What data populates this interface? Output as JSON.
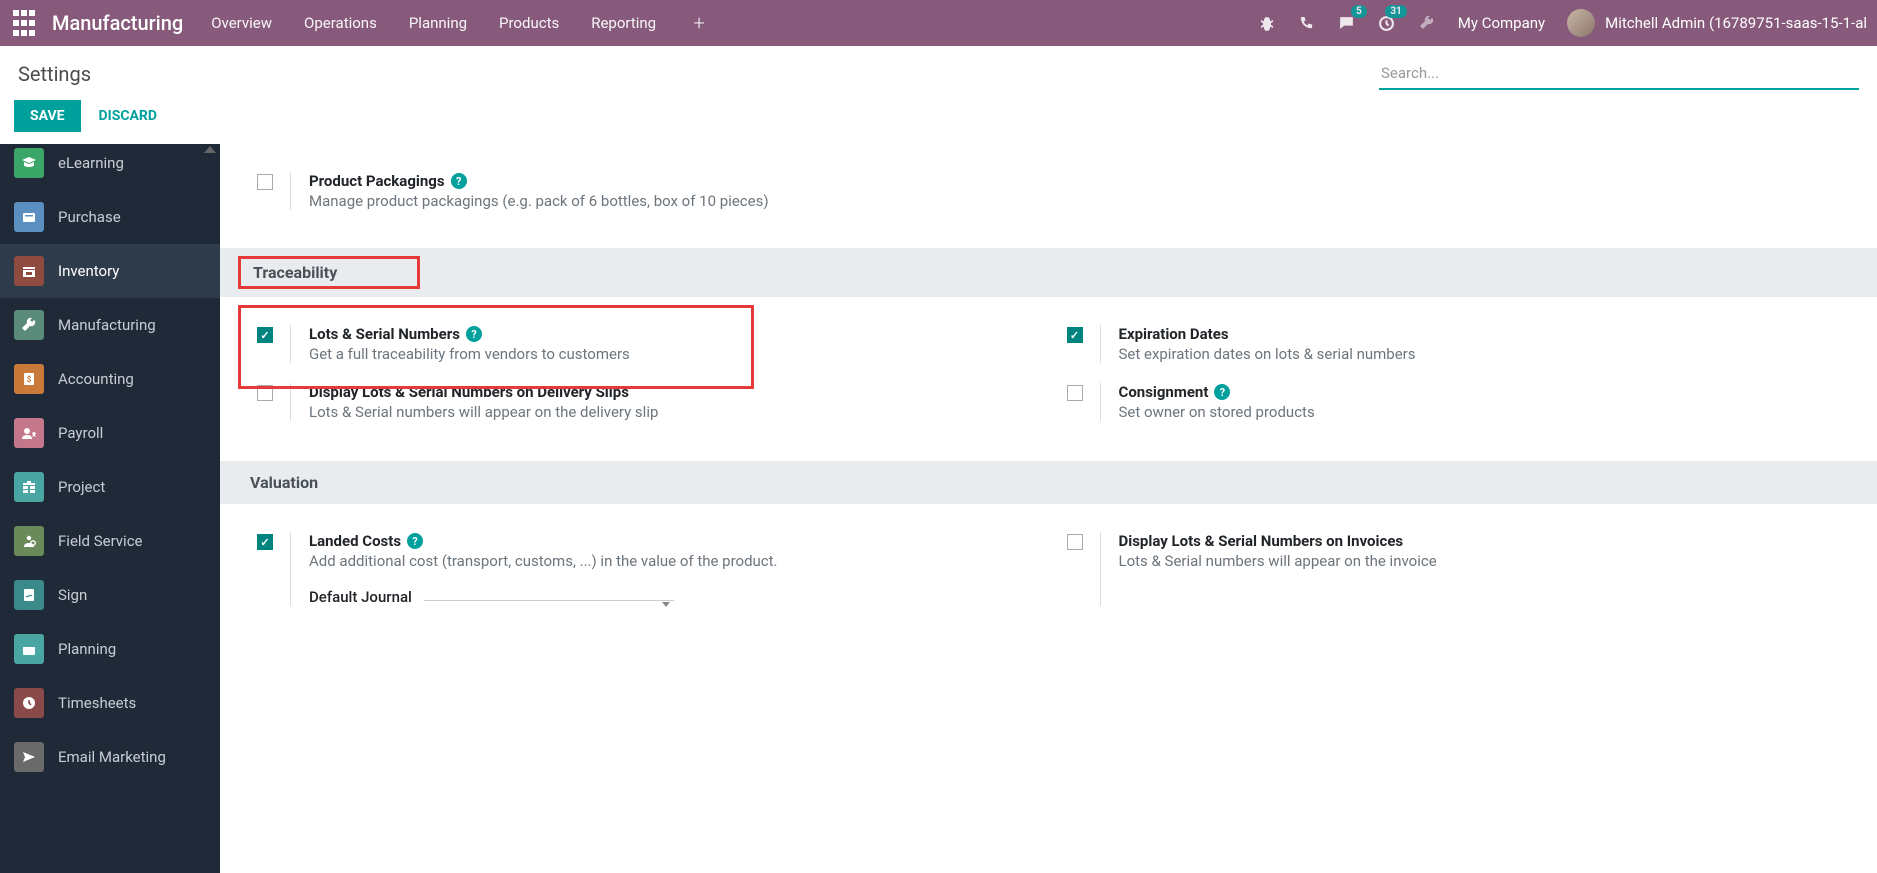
{
  "topbar": {
    "title": "Manufacturing",
    "nav": [
      "Overview",
      "Operations",
      "Planning",
      "Products",
      "Reporting"
    ],
    "messages_badge": "5",
    "activities_badge": "31",
    "company": "My Company",
    "user": "Mitchell Admin (16789751-saas-15-1-al"
  },
  "subheader": {
    "title": "Settings",
    "search_placeholder": "Search..."
  },
  "actions": {
    "save": "SAVE",
    "discard": "DISCARD"
  },
  "sidebar": {
    "items": [
      {
        "label": "eLearning",
        "color": "#3aa668"
      },
      {
        "label": "Purchase",
        "color": "#5a8fbf"
      },
      {
        "label": "Inventory",
        "color": "#8f4b3f",
        "active": true
      },
      {
        "label": "Manufacturing",
        "color": "#5a8a7a"
      },
      {
        "label": "Accounting",
        "color": "#c97a3a"
      },
      {
        "label": "Payroll",
        "color": "#c4768a"
      },
      {
        "label": "Project",
        "color": "#4aa6a3"
      },
      {
        "label": "Field Service",
        "color": "#6a8a5a"
      },
      {
        "label": "Sign",
        "color": "#3a8a8a"
      },
      {
        "label": "Planning",
        "color": "#4aa6a3"
      },
      {
        "label": "Timesheets",
        "color": "#8b4a4a"
      },
      {
        "label": "Email Marketing",
        "color": "#6a6a6a"
      }
    ]
  },
  "settings": {
    "top": {
      "packagings": {
        "label": "Product Packagings",
        "desc": "Manage product packagings (e.g. pack of 6 bottles, box of 10 pieces)"
      }
    },
    "traceability": {
      "title": "Traceability",
      "lots": {
        "label": "Lots & Serial Numbers",
        "desc": "Get a full traceability from vendors to customers"
      },
      "expiration": {
        "label": "Expiration Dates",
        "desc": "Set expiration dates on lots & serial numbers"
      },
      "delivery_slips": {
        "label": "Display Lots & Serial Numbers on Delivery Slips",
        "desc": "Lots & Serial numbers will appear on the delivery slip"
      },
      "consignment": {
        "label": "Consignment",
        "desc": "Set owner on stored products"
      }
    },
    "valuation": {
      "title": "Valuation",
      "landed": {
        "label": "Landed Costs",
        "desc": "Add additional cost (transport, customs, ...) in the value of the product.",
        "journal_label": "Default Journal"
      },
      "invoices": {
        "label": "Display Lots & Serial Numbers on Invoices",
        "desc": "Lots & Serial numbers will appear on the invoice"
      }
    }
  }
}
